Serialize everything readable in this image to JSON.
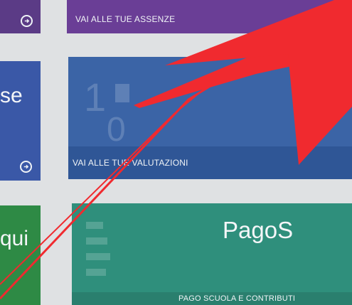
{
  "tiles": {
    "assenze": {
      "label": "VAI ALLE TUE ASSENZE"
    },
    "valutazioni": {
      "label": "VAI ALLE TUE VALUTAZIONI"
    },
    "pago": {
      "title": "PagoS",
      "label": "PAGO SCUOLA E CONTRIBUTI"
    },
    "left_blue": {
      "text": "se"
    },
    "left_green": {
      "text": "qui"
    }
  },
  "colors": {
    "purple": "#6a3e96",
    "blue": "#3b64a6",
    "teal": "#2f8f7c",
    "green": "#2e8a45",
    "annotation_red": "#f02a2f"
  },
  "icons": {
    "arrow_circle": "arrow-right-circle-icon",
    "grades": "grades-icon",
    "payments": "payments-icon"
  }
}
